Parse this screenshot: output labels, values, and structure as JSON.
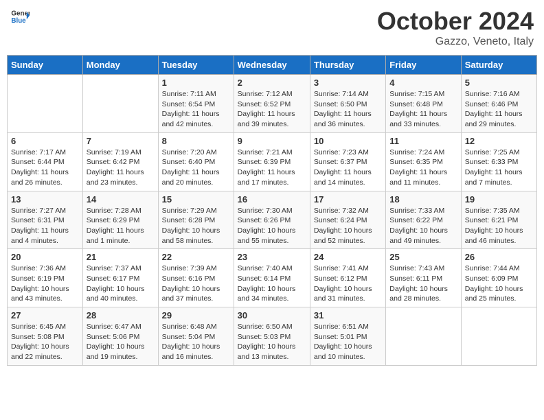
{
  "header": {
    "logo_line1": "General",
    "logo_line2": "Blue",
    "month": "October 2024",
    "location": "Gazzo, Veneto, Italy"
  },
  "weekdays": [
    "Sunday",
    "Monday",
    "Tuesday",
    "Wednesday",
    "Thursday",
    "Friday",
    "Saturday"
  ],
  "weeks": [
    [
      {
        "day": "",
        "sunrise": "",
        "sunset": "",
        "daylight": ""
      },
      {
        "day": "",
        "sunrise": "",
        "sunset": "",
        "daylight": ""
      },
      {
        "day": "1",
        "sunrise": "Sunrise: 7:11 AM",
        "sunset": "Sunset: 6:54 PM",
        "daylight": "Daylight: 11 hours and 42 minutes."
      },
      {
        "day": "2",
        "sunrise": "Sunrise: 7:12 AM",
        "sunset": "Sunset: 6:52 PM",
        "daylight": "Daylight: 11 hours and 39 minutes."
      },
      {
        "day": "3",
        "sunrise": "Sunrise: 7:14 AM",
        "sunset": "Sunset: 6:50 PM",
        "daylight": "Daylight: 11 hours and 36 minutes."
      },
      {
        "day": "4",
        "sunrise": "Sunrise: 7:15 AM",
        "sunset": "Sunset: 6:48 PM",
        "daylight": "Daylight: 11 hours and 33 minutes."
      },
      {
        "day": "5",
        "sunrise": "Sunrise: 7:16 AM",
        "sunset": "Sunset: 6:46 PM",
        "daylight": "Daylight: 11 hours and 29 minutes."
      }
    ],
    [
      {
        "day": "6",
        "sunrise": "Sunrise: 7:17 AM",
        "sunset": "Sunset: 6:44 PM",
        "daylight": "Daylight: 11 hours and 26 minutes."
      },
      {
        "day": "7",
        "sunrise": "Sunrise: 7:19 AM",
        "sunset": "Sunset: 6:42 PM",
        "daylight": "Daylight: 11 hours and 23 minutes."
      },
      {
        "day": "8",
        "sunrise": "Sunrise: 7:20 AM",
        "sunset": "Sunset: 6:40 PM",
        "daylight": "Daylight: 11 hours and 20 minutes."
      },
      {
        "day": "9",
        "sunrise": "Sunrise: 7:21 AM",
        "sunset": "Sunset: 6:39 PM",
        "daylight": "Daylight: 11 hours and 17 minutes."
      },
      {
        "day": "10",
        "sunrise": "Sunrise: 7:23 AM",
        "sunset": "Sunset: 6:37 PM",
        "daylight": "Daylight: 11 hours and 14 minutes."
      },
      {
        "day": "11",
        "sunrise": "Sunrise: 7:24 AM",
        "sunset": "Sunset: 6:35 PM",
        "daylight": "Daylight: 11 hours and 11 minutes."
      },
      {
        "day": "12",
        "sunrise": "Sunrise: 7:25 AM",
        "sunset": "Sunset: 6:33 PM",
        "daylight": "Daylight: 11 hours and 7 minutes."
      }
    ],
    [
      {
        "day": "13",
        "sunrise": "Sunrise: 7:27 AM",
        "sunset": "Sunset: 6:31 PM",
        "daylight": "Daylight: 11 hours and 4 minutes."
      },
      {
        "day": "14",
        "sunrise": "Sunrise: 7:28 AM",
        "sunset": "Sunset: 6:29 PM",
        "daylight": "Daylight: 11 hours and 1 minute."
      },
      {
        "day": "15",
        "sunrise": "Sunrise: 7:29 AM",
        "sunset": "Sunset: 6:28 PM",
        "daylight": "Daylight: 10 hours and 58 minutes."
      },
      {
        "day": "16",
        "sunrise": "Sunrise: 7:30 AM",
        "sunset": "Sunset: 6:26 PM",
        "daylight": "Daylight: 10 hours and 55 minutes."
      },
      {
        "day": "17",
        "sunrise": "Sunrise: 7:32 AM",
        "sunset": "Sunset: 6:24 PM",
        "daylight": "Daylight: 10 hours and 52 minutes."
      },
      {
        "day": "18",
        "sunrise": "Sunrise: 7:33 AM",
        "sunset": "Sunset: 6:22 PM",
        "daylight": "Daylight: 10 hours and 49 minutes."
      },
      {
        "day": "19",
        "sunrise": "Sunrise: 7:35 AM",
        "sunset": "Sunset: 6:21 PM",
        "daylight": "Daylight: 10 hours and 46 minutes."
      }
    ],
    [
      {
        "day": "20",
        "sunrise": "Sunrise: 7:36 AM",
        "sunset": "Sunset: 6:19 PM",
        "daylight": "Daylight: 10 hours and 43 minutes."
      },
      {
        "day": "21",
        "sunrise": "Sunrise: 7:37 AM",
        "sunset": "Sunset: 6:17 PM",
        "daylight": "Daylight: 10 hours and 40 minutes."
      },
      {
        "day": "22",
        "sunrise": "Sunrise: 7:39 AM",
        "sunset": "Sunset: 6:16 PM",
        "daylight": "Daylight: 10 hours and 37 minutes."
      },
      {
        "day": "23",
        "sunrise": "Sunrise: 7:40 AM",
        "sunset": "Sunset: 6:14 PM",
        "daylight": "Daylight: 10 hours and 34 minutes."
      },
      {
        "day": "24",
        "sunrise": "Sunrise: 7:41 AM",
        "sunset": "Sunset: 6:12 PM",
        "daylight": "Daylight: 10 hours and 31 minutes."
      },
      {
        "day": "25",
        "sunrise": "Sunrise: 7:43 AM",
        "sunset": "Sunset: 6:11 PM",
        "daylight": "Daylight: 10 hours and 28 minutes."
      },
      {
        "day": "26",
        "sunrise": "Sunrise: 7:44 AM",
        "sunset": "Sunset: 6:09 PM",
        "daylight": "Daylight: 10 hours and 25 minutes."
      }
    ],
    [
      {
        "day": "27",
        "sunrise": "Sunrise: 6:45 AM",
        "sunset": "Sunset: 5:08 PM",
        "daylight": "Daylight: 10 hours and 22 minutes."
      },
      {
        "day": "28",
        "sunrise": "Sunrise: 6:47 AM",
        "sunset": "Sunset: 5:06 PM",
        "daylight": "Daylight: 10 hours and 19 minutes."
      },
      {
        "day": "29",
        "sunrise": "Sunrise: 6:48 AM",
        "sunset": "Sunset: 5:04 PM",
        "daylight": "Daylight: 10 hours and 16 minutes."
      },
      {
        "day": "30",
        "sunrise": "Sunrise: 6:50 AM",
        "sunset": "Sunset: 5:03 PM",
        "daylight": "Daylight: 10 hours and 13 minutes."
      },
      {
        "day": "31",
        "sunrise": "Sunrise: 6:51 AM",
        "sunset": "Sunset: 5:01 PM",
        "daylight": "Daylight: 10 hours and 10 minutes."
      },
      {
        "day": "",
        "sunrise": "",
        "sunset": "",
        "daylight": ""
      },
      {
        "day": "",
        "sunrise": "",
        "sunset": "",
        "daylight": ""
      }
    ]
  ]
}
